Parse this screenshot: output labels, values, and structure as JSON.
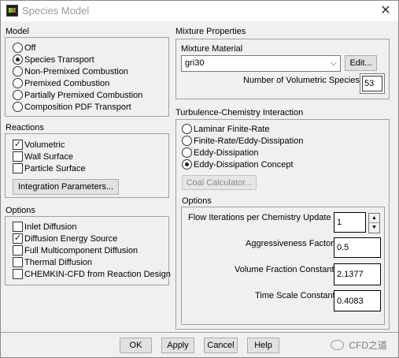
{
  "window": {
    "title": "Species Model",
    "close_glyph": "✕"
  },
  "model": {
    "heading": "Model",
    "options": [
      {
        "label": "Off",
        "checked": false
      },
      {
        "label": "Species Transport",
        "checked": true
      },
      {
        "label": "Non-Premixed Combustion",
        "checked": false
      },
      {
        "label": "Premixed Combustion",
        "checked": false
      },
      {
        "label": "Partially Premixed Combustion",
        "checked": false
      },
      {
        "label": "Composition PDF Transport",
        "checked": false
      }
    ]
  },
  "reactions": {
    "heading": "Reactions",
    "items": [
      {
        "label": "Volumetric",
        "checked": true
      },
      {
        "label": "Wall Surface",
        "checked": false
      },
      {
        "label": "Particle Surface",
        "checked": false
      }
    ],
    "integration_button": "Integration Parameters..."
  },
  "options_left": {
    "heading": "Options",
    "items": [
      {
        "label": "Inlet Diffusion",
        "checked": false
      },
      {
        "label": "Diffusion Energy Source",
        "checked": true
      },
      {
        "label": "Full Multicomponent Diffusion",
        "checked": false
      },
      {
        "label": "Thermal Diffusion",
        "checked": false
      },
      {
        "label": "CHEMKIN-CFD from Reaction Design",
        "checked": false
      }
    ]
  },
  "mixture": {
    "heading": "Mixture Properties",
    "material_label": "Mixture Material",
    "material_value": "gri30",
    "edit_button": "Edit...",
    "num_species_label": "Number of Volumetric Species",
    "num_species_value": "53"
  },
  "tci": {
    "heading": "Turbulence-Chemistry Interaction",
    "options": [
      {
        "label": "Laminar Finite-Rate",
        "checked": false
      },
      {
        "label": "Finite-Rate/Eddy-Dissipation",
        "checked": false
      },
      {
        "label": "Eddy-Dissipation",
        "checked": false
      },
      {
        "label": "Eddy-Dissipation Concept",
        "checked": true
      }
    ],
    "coal_button": "Coal Calculator..."
  },
  "options_right": {
    "heading": "Options",
    "flow_iter_label": "Flow Iterations per Chemistry Update",
    "flow_iter_value": "1",
    "aggr_label": "Aggressiveness Factor",
    "aggr_value": "0.5",
    "vol_frac_label": "Volume Fraction Constant",
    "vol_frac_value": "2.1377",
    "time_scale_label": "Time Scale Constant",
    "time_scale_value": "0.4083"
  },
  "footer": {
    "ok": "OK",
    "apply": "Apply",
    "cancel": "Cancel",
    "help": "Help"
  },
  "watermark": {
    "text": "CFD之道"
  },
  "icons": {
    "check": "✓",
    "dropdown": "⌵",
    "spin_up": "▲",
    "spin_down": "▼"
  }
}
